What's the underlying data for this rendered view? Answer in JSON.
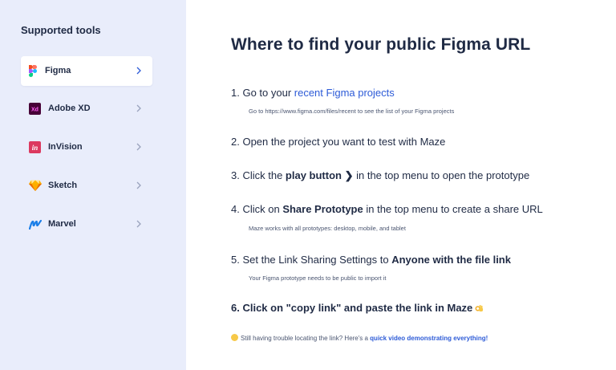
{
  "sidebar": {
    "title": "Supported tools",
    "items": [
      {
        "label": "Figma",
        "icon": "figma-icon",
        "active": true
      },
      {
        "label": "Adobe XD",
        "icon": "adobe-xd-icon",
        "active": false
      },
      {
        "label": "InVision",
        "icon": "invision-icon",
        "active": false
      },
      {
        "label": "Sketch",
        "icon": "sketch-icon",
        "active": false
      },
      {
        "label": "Marvel",
        "icon": "marvel-icon",
        "active": false
      }
    ]
  },
  "main": {
    "title": "Where to find your public Figma URL",
    "steps": [
      {
        "prefix": "1. Go to your ",
        "link": "recent Figma projects",
        "sub": "Go to https://www.figma.com/files/recent to see the list of your Figma projects"
      },
      {
        "text": "2. Open the project you want to test with Maze"
      },
      {
        "prefix": "3. Click the ",
        "bold": "play button ❯",
        "suffix": " in the top menu to open the prototype"
      },
      {
        "prefix": "4. Click on ",
        "bold": "Share Prototype",
        "suffix": " in the top menu to create a share URL",
        "sub": "Maze works with all prototypes: desktop, mobile, and tablet"
      },
      {
        "prefix": "5. Set the Link Sharing Settings to ",
        "bold": "Anyone with the file link",
        "sub": "Your Figma prototype needs to be public to import it"
      },
      {
        "bold": "6. Click on \"copy link\" and paste the link in Maze"
      }
    ],
    "footnote": {
      "text": "Still having trouble locating the link? Here's a ",
      "link": "quick video demonstrating everything!"
    }
  },
  "colors": {
    "sidebar_bg": "#e9edfb",
    "text": "#1f2a44",
    "link": "#2d5bd7"
  }
}
